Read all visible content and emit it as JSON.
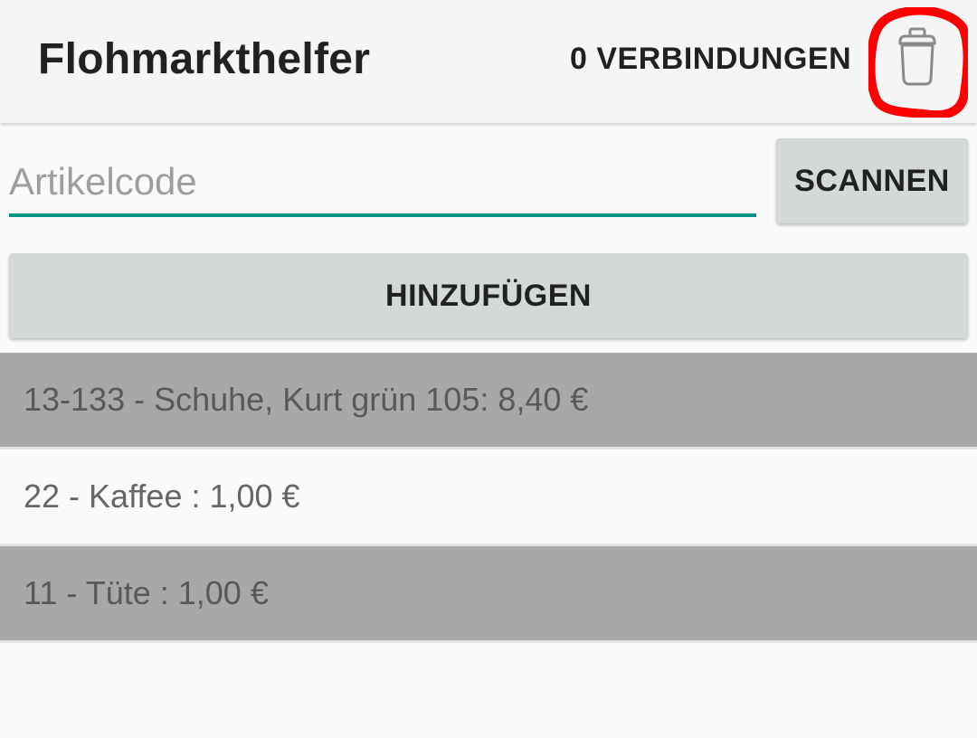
{
  "appbar": {
    "title": "Flohmarkthelfer",
    "connections_label": "0 VERBINDUNGEN",
    "trash_icon": "trash-icon",
    "highlight_color": "#ff0000"
  },
  "search": {
    "placeholder": "Artikelcode",
    "value": "",
    "accent_color": "#009688",
    "scan_label": "SCANNEN"
  },
  "actions": {
    "add_label": "HINZUFÜGEN"
  },
  "items": [
    {
      "text": "13-133 - Schuhe, Kurt grün 105: 8,40 €",
      "shaded": true
    },
    {
      "text": "22 - Kaffee : 1,00 €",
      "shaded": false
    },
    {
      "text": "11 - Tüte : 1,00 €",
      "shaded": true
    }
  ]
}
